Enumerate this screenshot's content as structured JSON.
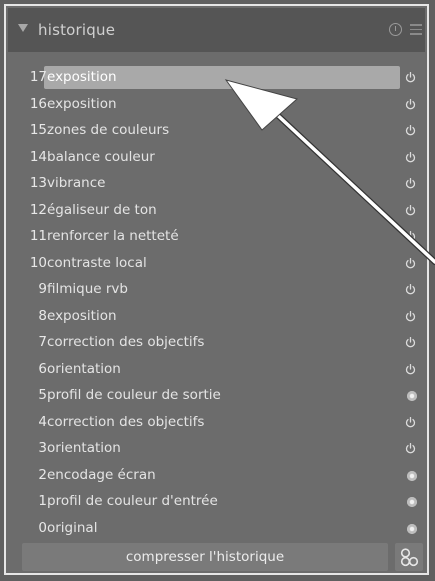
{
  "panel": {
    "title": "historique",
    "items": [
      {
        "num": "17",
        "label": "exposition",
        "state": "power",
        "selected": true
      },
      {
        "num": "16",
        "label": "exposition",
        "state": "power"
      },
      {
        "num": "15",
        "label": "zones de couleurs",
        "state": "power"
      },
      {
        "num": "14",
        "label": "balance couleur",
        "state": "power"
      },
      {
        "num": "13",
        "label": "vibrance",
        "state": "power"
      },
      {
        "num": "12",
        "label": "égaliseur de ton",
        "state": "power"
      },
      {
        "num": "11",
        "label": "renforcer la netteté",
        "state": "power"
      },
      {
        "num": "10",
        "label": "contraste local",
        "state": "power"
      },
      {
        "num": "9",
        "label": "filmique rvb",
        "state": "power"
      },
      {
        "num": "8",
        "label": "exposition",
        "state": "power"
      },
      {
        "num": "7",
        "label": "correction des objectifs",
        "state": "power"
      },
      {
        "num": "6",
        "label": "orientation",
        "state": "power"
      },
      {
        "num": "5",
        "label": "profil de couleur de sortie",
        "state": "always-on"
      },
      {
        "num": "4",
        "label": "correction des objectifs",
        "state": "power"
      },
      {
        "num": "3",
        "label": "orientation",
        "state": "power"
      },
      {
        "num": "2",
        "label": "encodage écran",
        "state": "always-on"
      },
      {
        "num": "1",
        "label": "profil de couleur d'entrée",
        "state": "always-on"
      },
      {
        "num": "0",
        "label": "original",
        "state": "always-on"
      }
    ],
    "compress_label": "compresser l'historique"
  }
}
